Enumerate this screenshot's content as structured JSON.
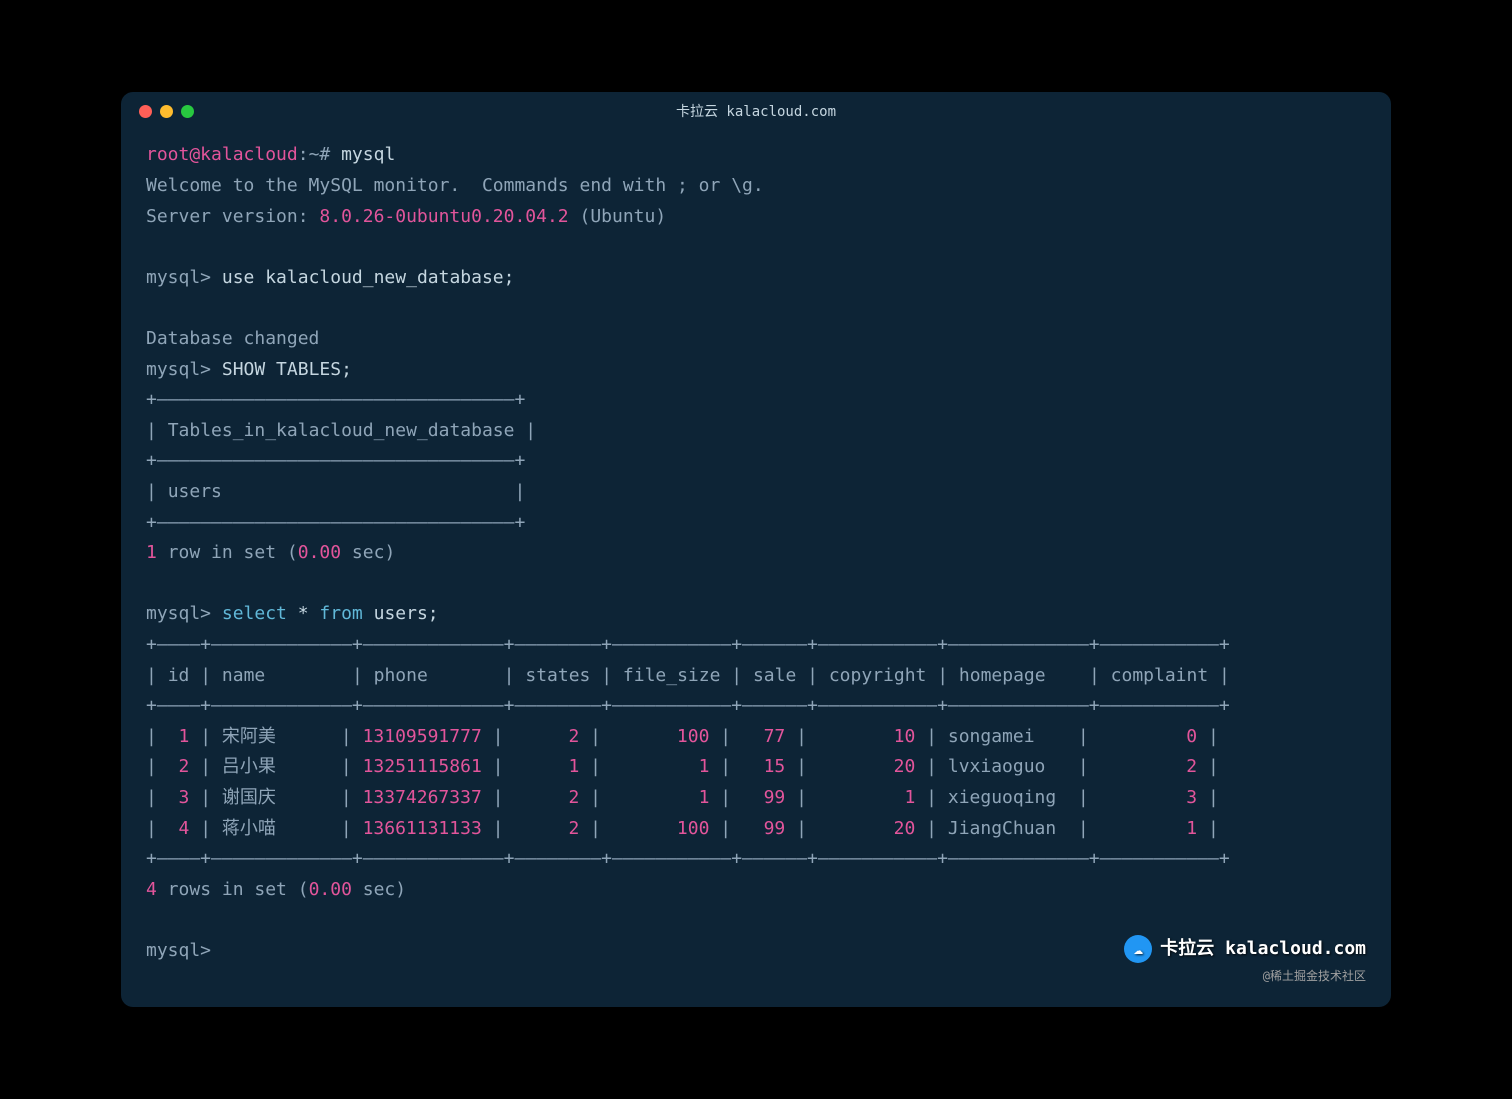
{
  "window": {
    "title": "卡拉云 kalacloud.com"
  },
  "terminal": {
    "prompt_user": "root@kalacloud",
    "prompt_path": "~#",
    "mysql_prompt": "mysql>",
    "cmd_mysql": "mysql",
    "welcome_line": "Welcome to the MySQL monitor.  Commands end with ; or \\g.",
    "server_version_label": "Server version: ",
    "server_version": "8.0.26-0ubuntu0.20.04.2",
    "server_version_suffix": " (Ubuntu)",
    "cmd_use": "use kalacloud_new_database;",
    "db_changed": "Database changed",
    "cmd_show_tables": "SHOW TABLES;",
    "tables_header": "Tables_in_kalacloud_new_database",
    "tables_row": "users",
    "rows_1": "1",
    "row_in_set": " row in set (",
    "time_0": "0.00",
    "sec": " sec)",
    "cmd_select": "select * from users;",
    "rows_4": "4",
    "rows_in_set": " rows in set (",
    "table_border_top": "+—————————————————————————————————+",
    "users_border": "+————+—————————————+—————————————+————————+———————————+——————+———————————+—————————————+———————————+",
    "columns": {
      "id": "id",
      "name": "name",
      "phone": "phone",
      "states": "states",
      "file_size": "file_size",
      "sale": "sale",
      "copyright": "copyright",
      "homepage": "homepage",
      "complaint": "complaint"
    },
    "rows": [
      {
        "id": "1",
        "name": "宋阿美",
        "phone": "13109591777",
        "states": "2",
        "file_size": "100",
        "sale": "77",
        "copyright": "10",
        "homepage": "songamei",
        "complaint": "0"
      },
      {
        "id": "2",
        "name": "吕小果",
        "phone": "13251115861",
        "states": "1",
        "file_size": "1",
        "sale": "15",
        "copyright": "20",
        "homepage": "lvxiaoguo",
        "complaint": "2"
      },
      {
        "id": "3",
        "name": "谢国庆",
        "phone": "13374267337",
        "states": "2",
        "file_size": "1",
        "sale": "99",
        "copyright": "1",
        "homepage": "xieguoqing",
        "complaint": "3"
      },
      {
        "id": "4",
        "name": "蒋小喵",
        "phone": "13661131133",
        "states": "2",
        "file_size": "100",
        "sale": "99",
        "copyright": "20",
        "homepage": "JiangChuan",
        "complaint": "1"
      }
    ]
  },
  "watermark": {
    "main": "卡拉云 kalacloud.com",
    "sub": "@稀土掘金技术社区"
  }
}
